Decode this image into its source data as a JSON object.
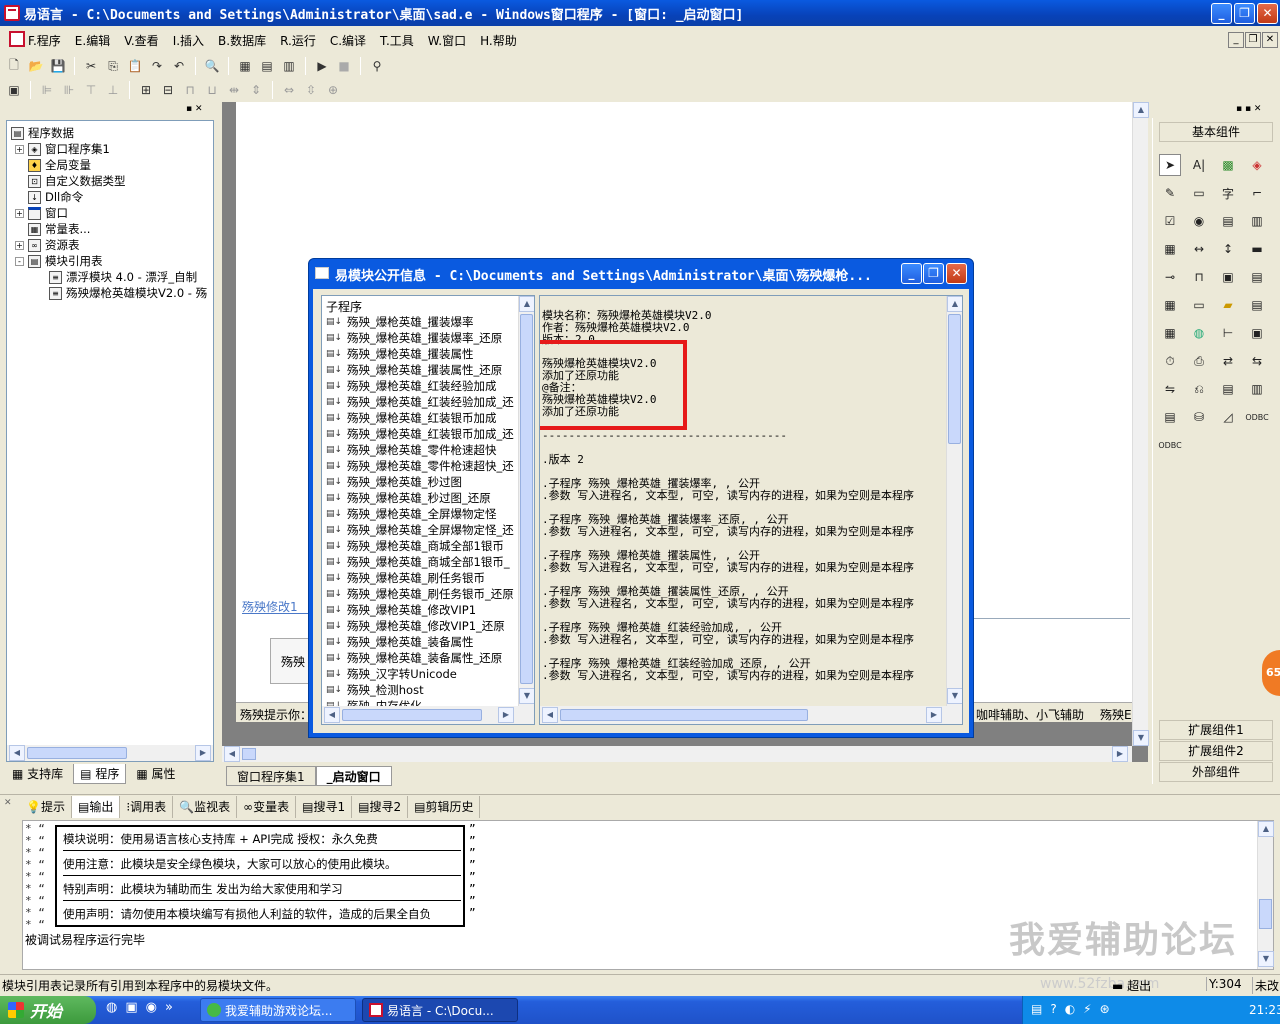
{
  "window": {
    "title": "易语言 - C:\\Documents and Settings\\Administrator\\桌面\\sad.e - Windows窗口程序 - [窗口: _启动窗口]"
  },
  "menu": [
    "F.程序",
    "E.编辑",
    "V.查看",
    "I.插入",
    "B.数据库",
    "R.运行",
    "C.编译",
    "T.工具",
    "W.窗口",
    "H.帮助"
  ],
  "tree": {
    "root": "程序数据",
    "items": [
      {
        "label": "窗口程序集1",
        "expander": "+"
      },
      {
        "label": "全局变量",
        "expander": ""
      },
      {
        "label": "自定义数据类型",
        "expander": ""
      },
      {
        "label": "Dll命令",
        "expander": ""
      },
      {
        "label": "窗口",
        "expander": "+"
      },
      {
        "label": "常量表...",
        "expander": ""
      },
      {
        "label": "资源表",
        "expander": "+"
      },
      {
        "label": "模块引用表",
        "expander": "-"
      },
      {
        "label": "漂浮模块 4.0 - 漂浮_自制",
        "expander": ""
      },
      {
        "label": "殇殃爆枪英雄模块V2.0 - 殇",
        "expander": ""
      }
    ]
  },
  "left_tabs": [
    "支持库",
    "程序",
    "属性"
  ],
  "editor": {
    "tab_label": "殇殃修改1",
    "button_label": "殇殃",
    "hint_label": "殇殃提示你：",
    "right_label": "咖啡辅助、小飞辅助",
    "right_label2": "殇殃E",
    "doc_tabs": [
      "窗口程序集1",
      "_启动窗口"
    ]
  },
  "dialog": {
    "title": "易模块公开信息 - C:\\Documents and Settings\\Administrator\\桌面\\殇殃爆枪...",
    "list_header": "子程序",
    "functions": [
      "殇殃_爆枪英雄_攫装爆率",
      "殇殃_爆枪英雄_攫装爆率_还原",
      "殇殃_爆枪英雄_攫装属性",
      "殇殃_爆枪英雄_攫装属性_还原",
      "殇殃_爆枪英雄_红装经验加成",
      "殇殃_爆枪英雄_红装经验加成_还",
      "殇殃_爆枪英雄_红装银币加成",
      "殇殃_爆枪英雄_红装银币加成_还",
      "殇殃_爆枪英雄_零件枪速超快",
      "殇殃_爆枪英雄_零件枪速超快_还",
      "殇殃_爆枪英雄_秒过图",
      "殇殃_爆枪英雄_秒过图_还原",
      "殇殃_爆枪英雄_全屏爆物定怪",
      "殇殃_爆枪英雄_全屏爆物定怪_还",
      "殇殃_爆枪英雄_商城全部1银币",
      "殇殃_爆枪英雄_商城全部1银币_",
      "殇殃_爆枪英雄_刷任务银币",
      "殇殃_爆枪英雄_刷任务银币_还原",
      "殇殃_爆枪英雄_修改VIP1",
      "殇殃_爆枪英雄_修改VIP1_还原",
      "殇殃_爆枪英雄_装备属性",
      "殇殃_爆枪英雄_装备属性_还原",
      "殇殃_汉字转Unicode",
      "殇殃_检测host",
      "殇殃_内存优化"
    ],
    "info_header": [
      "模块名称：殇殃爆枪英雄模块V2.0",
      "作者：殇殃爆枪英雄模块V2.0",
      "版本：2.0",
      "",
      "殇殃爆枪英雄模块V2.0",
      "添加了还原功能",
      "@备注：",
      "殇殃爆枪英雄模块V2.0",
      "添加了还原功能",
      "",
      "-------------------------------------"
    ],
    "version_line": ".版本 2",
    "entries": [
      {
        "sub": ".子程序 殇殃_爆枪英雄_攫装爆率, , 公开",
        "param": ".参数 写入进程名, 文本型, 可空, 读写内存的进程，如果为空则是本程序"
      },
      {
        "sub": ".子程序 殇殃_爆枪英雄_攫装爆率_还原, , 公开",
        "param": ".参数 写入进程名, 文本型, 可空, 读写内存的进程，如果为空则是本程序"
      },
      {
        "sub": ".子程序 殇殃_爆枪英雄_攫装属性, , 公开",
        "param": ".参数 写入进程名, 文本型, 可空, 读写内存的进程，如果为空则是本程序"
      },
      {
        "sub": ".子程序 殇殃_爆枪英雄_攫装属性_还原, , 公开",
        "param": ".参数 写入进程名, 文本型, 可空, 读写内存的进程，如果为空则是本程序"
      },
      {
        "sub": ".子程序 殇殃_爆枪英雄_红装经验加成, , 公开",
        "param": ".参数 写入进程名, 文本型, 可空, 读写内存的进程，如果为空则是本程序"
      },
      {
        "sub": ".子程序 殇殃_爆枪英雄_红装经验加成_还原, , 公开",
        "param": ".参数 写入进程名, 文本型, 可空, 读写内存的进程，如果为空则是本程序"
      }
    ]
  },
  "palette": {
    "title": "基本组件",
    "buttons": [
      "扩展组件1",
      "扩展组件2",
      "外部组件"
    ]
  },
  "bottom_tabs": [
    "提示",
    "输出",
    "调用表",
    "监视表",
    "变量表",
    "搜寻1",
    "搜寻2",
    "剪辑历史"
  ],
  "output": {
    "rows": [
      "模块说明：使用易语言核心支持库 + API完成      授权：永久免费",
      "使用注意：此模块是安全绿色模块，大家可以放心的使用此模块。",
      "特别声明：此模块为辅助而生 发出为给大家使用和学习",
      "使用声明：请勿使用本模块编写有损他人利益的软件，造成的后果全自负"
    ],
    "footer": "被调试易程序运行完毕",
    "watermark": "我爱辅助论坛",
    "watermark2": "www.52fzba.com"
  },
  "statusbar": {
    "text": "模块引用表记录所有引用到本程序中的易模块文件。",
    "mode": "超出",
    "position": "Y:304",
    "state": "未改"
  },
  "taskbar": {
    "start": "开始",
    "items": [
      "我爱辅助游戏论坛...",
      "易语言 - C:\\Docu..."
    ],
    "clock": "21:23"
  },
  "badge": "65"
}
